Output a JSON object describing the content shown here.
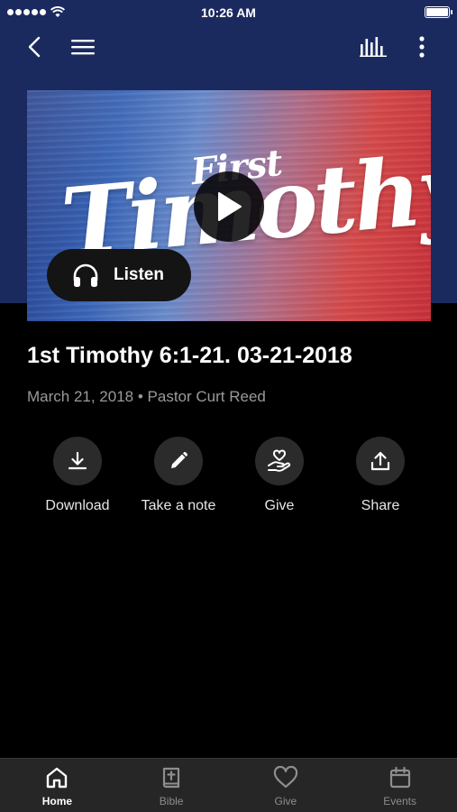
{
  "status_bar": {
    "time": "10:26 AM",
    "signal_icon": "signal-dots-icon",
    "wifi_icon": "wifi-icon",
    "battery_icon": "battery-icon",
    "battery_level": 1.0
  },
  "nav": {
    "back_icon": "chevron-left-icon",
    "menu_icon": "hamburger-menu-icon",
    "equalizer_icon": "audio-bars-icon",
    "more_icon": "vertical-dots-icon"
  },
  "artwork": {
    "first_text": "First",
    "title_text": "Timothy",
    "play_icon": "play-icon"
  },
  "listen_button": {
    "label": "Listen",
    "icon": "headphones-icon"
  },
  "sermon": {
    "title": "1st Timothy 6:1-21. 03-21-2018",
    "meta": "March 21, 2018 • Pastor Curt Reed"
  },
  "actions": [
    {
      "label": "Download",
      "icon": "download-icon"
    },
    {
      "label": "Take a note",
      "icon": "pencil-icon"
    },
    {
      "label": "Give",
      "icon": "hand-heart-icon"
    },
    {
      "label": "Share",
      "icon": "share-icon"
    }
  ],
  "tabs": [
    {
      "label": "Home",
      "icon": "home-icon",
      "active": true
    },
    {
      "label": "Bible",
      "icon": "bible-icon",
      "active": false
    },
    {
      "label": "Give",
      "icon": "heart-icon",
      "active": false
    },
    {
      "label": "Events",
      "icon": "calendar-icon",
      "active": false
    }
  ],
  "colors": {
    "header_background": "#1b2a5e",
    "page_background": "#000000",
    "tab_bar_background": "#262626",
    "action_circle": "#2b2b2b",
    "meta_text": "#9a9a9a"
  }
}
